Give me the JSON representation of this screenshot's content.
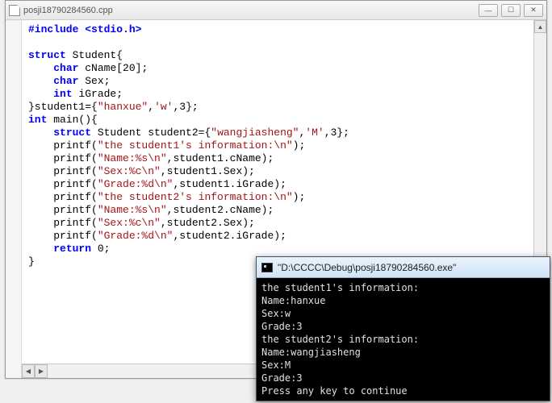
{
  "editor": {
    "filename": "posji18790284560.cpp",
    "code_lines": [
      {
        "t": "pp",
        "text": "#include <stdio.h>"
      },
      {
        "t": "blank",
        "text": ""
      },
      {
        "t": "struct",
        "text": "struct Student{"
      },
      {
        "t": "decl",
        "indent": 1,
        "kw": "char",
        "rest": " cName[20];"
      },
      {
        "t": "decl",
        "indent": 1,
        "kw": "char",
        "rest": " Sex;"
      },
      {
        "t": "decl",
        "indent": 1,
        "kw": "int",
        "rest": " iGrade;"
      },
      {
        "t": "plain",
        "text": "}student1={\"hanxue\",'w',3};"
      },
      {
        "t": "main",
        "text": "int main(){"
      },
      {
        "t": "decl",
        "indent": 1,
        "kw": "struct",
        "rest": " Student student2={\"wangjiasheng\",'M',3};"
      },
      {
        "t": "call",
        "indent": 1,
        "text": "printf(\"the student1's information:\\n\");"
      },
      {
        "t": "call",
        "indent": 1,
        "text": "printf(\"Name:%s\\n\",student1.cName);"
      },
      {
        "t": "call",
        "indent": 1,
        "text": "printf(\"Sex:%c\\n\",student1.Sex);"
      },
      {
        "t": "call",
        "indent": 1,
        "text": "printf(\"Grade:%d\\n\",student1.iGrade);"
      },
      {
        "t": "call",
        "indent": 1,
        "text": "printf(\"the student2's information:\\n\");"
      },
      {
        "t": "call",
        "indent": 1,
        "text": "printf(\"Name:%s\\n\",student2.cName);"
      },
      {
        "t": "call",
        "indent": 1,
        "text": "printf(\"Sex:%c\\n\",student2.Sex);"
      },
      {
        "t": "call",
        "indent": 1,
        "text": "printf(\"Grade:%d\\n\",student2.iGrade);"
      },
      {
        "t": "ret",
        "indent": 1,
        "kw": "return",
        "rest": " 0;"
      },
      {
        "t": "plain",
        "text": "}"
      }
    ]
  },
  "console": {
    "title": "\"D:\\CCCC\\Debug\\posji18790284560.exe\"",
    "lines": [
      "the student1's information:",
      "Name:hanxue",
      "Sex:w",
      "Grade:3",
      "the student2's information:",
      "Name:wangjiasheng",
      "Sex:M",
      "Grade:3",
      "Press any key to continue"
    ]
  },
  "glyphs": {
    "min": "—",
    "max": "☐",
    "close": "✕",
    "up": "▲",
    "down": "▼",
    "left": "◀",
    "right": "▶"
  }
}
